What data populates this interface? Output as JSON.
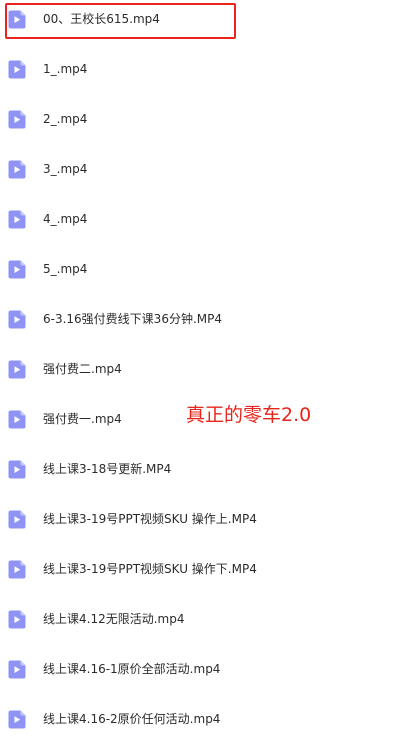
{
  "files": [
    {
      "name": "00、王校长615.mp4",
      "icon": "video-file-icon"
    },
    {
      "name": "1_.mp4",
      "icon": "video-file-icon"
    },
    {
      "name": "2_.mp4",
      "icon": "video-file-icon"
    },
    {
      "name": "3_.mp4",
      "icon": "video-file-icon"
    },
    {
      "name": "4_.mp4",
      "icon": "video-file-icon"
    },
    {
      "name": "5_.mp4",
      "icon": "video-file-icon"
    },
    {
      "name": "6-3.16强付费线下课36分钟.MP4",
      "icon": "video-file-icon"
    },
    {
      "name": "强付费二.mp4",
      "icon": "video-file-icon"
    },
    {
      "name": "强付费一.mp4",
      "icon": "video-file-icon"
    },
    {
      "name": "线上课3-18号更新.MP4",
      "icon": "video-file-icon"
    },
    {
      "name": "线上课3-19号PPT视频SKU 操作上.MP4",
      "icon": "video-file-icon"
    },
    {
      "name": "线上课3-19号PPT视频SKU 操作下.MP4",
      "icon": "video-file-icon"
    },
    {
      "name": "线上课4.12无限活动.mp4",
      "icon": "video-file-icon"
    },
    {
      "name": "线上课4.16-1原价全部活动.mp4",
      "icon": "video-file-icon"
    },
    {
      "name": "线上课4.16-2原价任何活动.mp4",
      "icon": "video-file-icon"
    }
  ],
  "annotation": {
    "text": "真正的零车2.0",
    "color": "#e8241c"
  },
  "colors": {
    "icon_fill": "#8f93f4",
    "icon_fold": "#c3c6fa",
    "text": "#2b2b2b",
    "highlight": "#e8241c"
  }
}
